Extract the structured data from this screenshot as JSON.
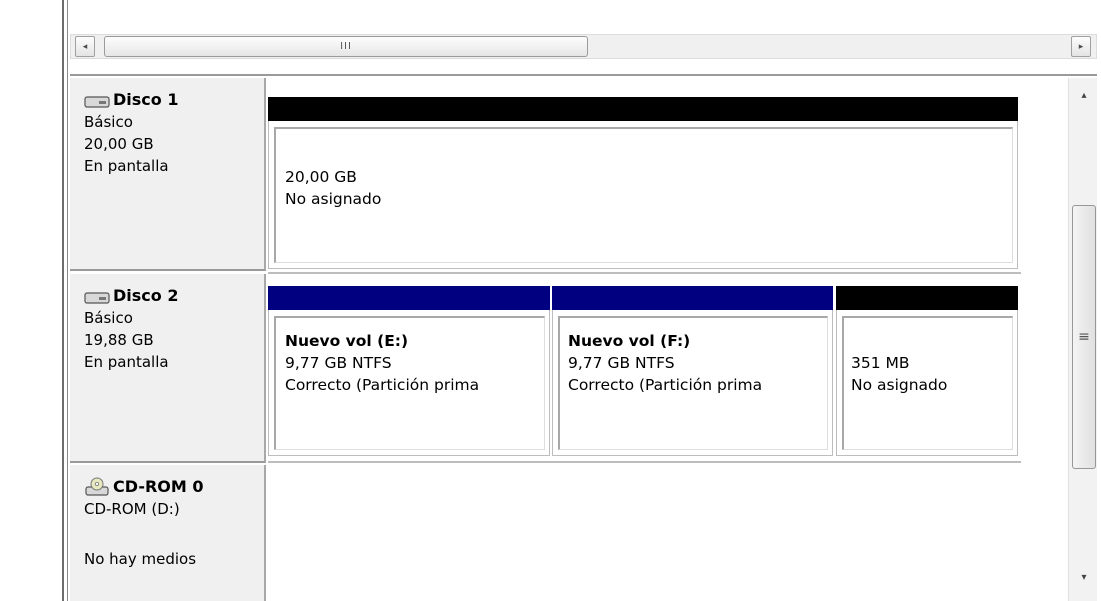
{
  "hscroll": {
    "left_arrow": "◂",
    "right_arrow": "▸",
    "thumb_grip": "III"
  },
  "vscroll": {
    "up_arrow": "▴",
    "down_arrow": "▾",
    "thumb_grip": "≡"
  },
  "disks": [
    {
      "name": "Disco 1",
      "type": "Básico",
      "size": "20,00 GB",
      "status": "En pantalla",
      "icon": "disk-drive-icon",
      "partitions": [
        {
          "title": "",
          "line1": "20,00 GB",
          "line2": "No asignado",
          "bar_color": "#000000"
        }
      ]
    },
    {
      "name": "Disco 2",
      "type": "Básico",
      "size": "19,88 GB",
      "status": "En pantalla",
      "icon": "disk-drive-icon",
      "partitions": [
        {
          "title": "Nuevo vol  (E:)",
          "line1": "9,77 GB NTFS",
          "line2": "Correcto (Partición prima",
          "bar_color": "#000080"
        },
        {
          "title": "Nuevo vol  (F:)",
          "line1": "9,77 GB NTFS",
          "line2": "Correcto (Partición prima",
          "bar_color": "#000080"
        },
        {
          "title": "",
          "line1": "351 MB",
          "line2": "No asignado",
          "bar_color": "#000000"
        }
      ]
    },
    {
      "name": "CD-ROM 0",
      "type": "CD-ROM (D:)",
      "size": "",
      "status": "No hay medios",
      "icon": "cdrom-drive-icon"
    }
  ]
}
